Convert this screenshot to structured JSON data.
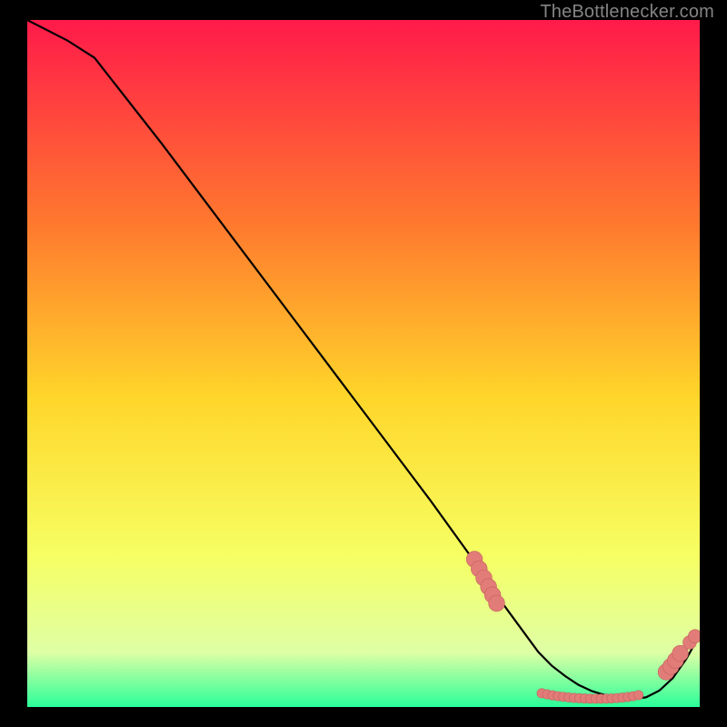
{
  "attribution": "TheBottlenecker.com",
  "colors": {
    "gradient_top": "#ff1a4a",
    "gradient_mid1": "#ff7a2e",
    "gradient_mid2": "#ffd62a",
    "gradient_mid3": "#f6ff63",
    "gradient_mid4": "#dfffa5",
    "gradient_bottom": "#2aff9a",
    "curve": "#000000",
    "marker_fill": "#e27c78",
    "marker_stroke": "#c4615f"
  },
  "chart_data": {
    "type": "line",
    "title": "",
    "xlabel": "",
    "ylabel": "",
    "xlim": [
      0,
      100
    ],
    "ylim": [
      0,
      100
    ],
    "x": [
      0,
      6,
      10,
      20,
      30,
      40,
      50,
      60,
      67,
      70,
      73,
      76,
      78,
      80,
      82,
      84,
      86,
      88,
      90,
      92,
      94,
      96,
      98,
      100
    ],
    "values": [
      100,
      97,
      94.5,
      82,
      69,
      56,
      43,
      30,
      20.5,
      16,
      12,
      8,
      6,
      4.5,
      3.2,
      2.3,
      1.7,
      1.3,
      1.2,
      1.4,
      2.4,
      4.2,
      7.0,
      10.5
    ],
    "markers": [
      {
        "x": 66.5,
        "y": 21.5,
        "r": 1.2
      },
      {
        "x": 67.2,
        "y": 20.1,
        "r": 1.2
      },
      {
        "x": 67.9,
        "y": 18.8,
        "r": 1.2
      },
      {
        "x": 68.6,
        "y": 17.5,
        "r": 1.2
      },
      {
        "x": 69.2,
        "y": 16.3,
        "r": 1.2
      },
      {
        "x": 69.8,
        "y": 15.1,
        "r": 1.2
      },
      {
        "x": 76.5,
        "y": 2.0,
        "r": 0.7
      },
      {
        "x": 77.3,
        "y": 1.85,
        "r": 0.7
      },
      {
        "x": 78.1,
        "y": 1.7,
        "r": 0.7
      },
      {
        "x": 78.9,
        "y": 1.58,
        "r": 0.7
      },
      {
        "x": 79.7,
        "y": 1.48,
        "r": 0.7
      },
      {
        "x": 80.5,
        "y": 1.4,
        "r": 0.7
      },
      {
        "x": 81.3,
        "y": 1.33,
        "r": 0.7
      },
      {
        "x": 82.1,
        "y": 1.28,
        "r": 0.7
      },
      {
        "x": 82.9,
        "y": 1.24,
        "r": 0.7
      },
      {
        "x": 83.7,
        "y": 1.21,
        "r": 0.7
      },
      {
        "x": 84.5,
        "y": 1.2,
        "r": 0.7
      },
      {
        "x": 85.3,
        "y": 1.2,
        "r": 0.7
      },
      {
        "x": 86.1,
        "y": 1.22,
        "r": 0.7
      },
      {
        "x": 86.9,
        "y": 1.25,
        "r": 0.7
      },
      {
        "x": 87.7,
        "y": 1.3,
        "r": 0.7
      },
      {
        "x": 88.5,
        "y": 1.37,
        "r": 0.7
      },
      {
        "x": 89.3,
        "y": 1.46,
        "r": 0.7
      },
      {
        "x": 90.1,
        "y": 1.58,
        "r": 0.7
      },
      {
        "x": 90.9,
        "y": 1.73,
        "r": 0.7
      },
      {
        "x": 95.0,
        "y": 5.1,
        "r": 1.2
      },
      {
        "x": 95.7,
        "y": 5.9,
        "r": 1.2
      },
      {
        "x": 96.4,
        "y": 6.8,
        "r": 1.2
      },
      {
        "x": 97.1,
        "y": 7.8,
        "r": 1.2
      },
      {
        "x": 98.5,
        "y": 9.4,
        "r": 1.0
      },
      {
        "x": 99.3,
        "y": 10.3,
        "r": 1.0
      }
    ]
  }
}
